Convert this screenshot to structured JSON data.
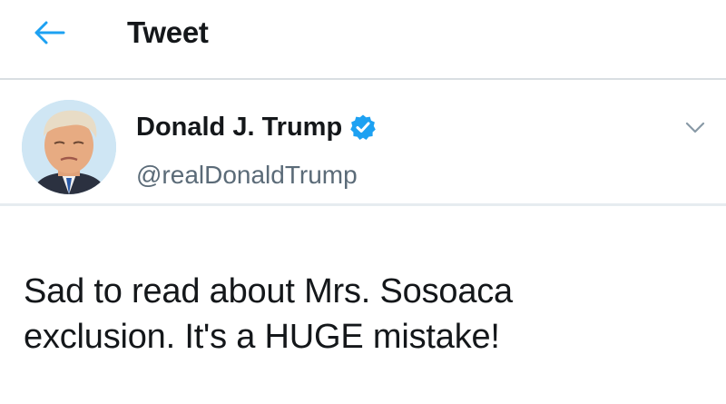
{
  "header": {
    "back_icon": "arrow-left-icon",
    "title": "Tweet",
    "accent_color": "#1da1f2"
  },
  "author": {
    "display_name": "Donald J. Trump",
    "handle": "@realDonaldTrump",
    "verified_icon": "verified-badge-icon",
    "verified_color": "#1da1f2",
    "menu_icon": "chevron-down-icon"
  },
  "tweet": {
    "text_line_1": "Sad to read about Mrs. Sosoaca",
    "text_line_2": "exclusion. It's a HUGE mistake!"
  }
}
